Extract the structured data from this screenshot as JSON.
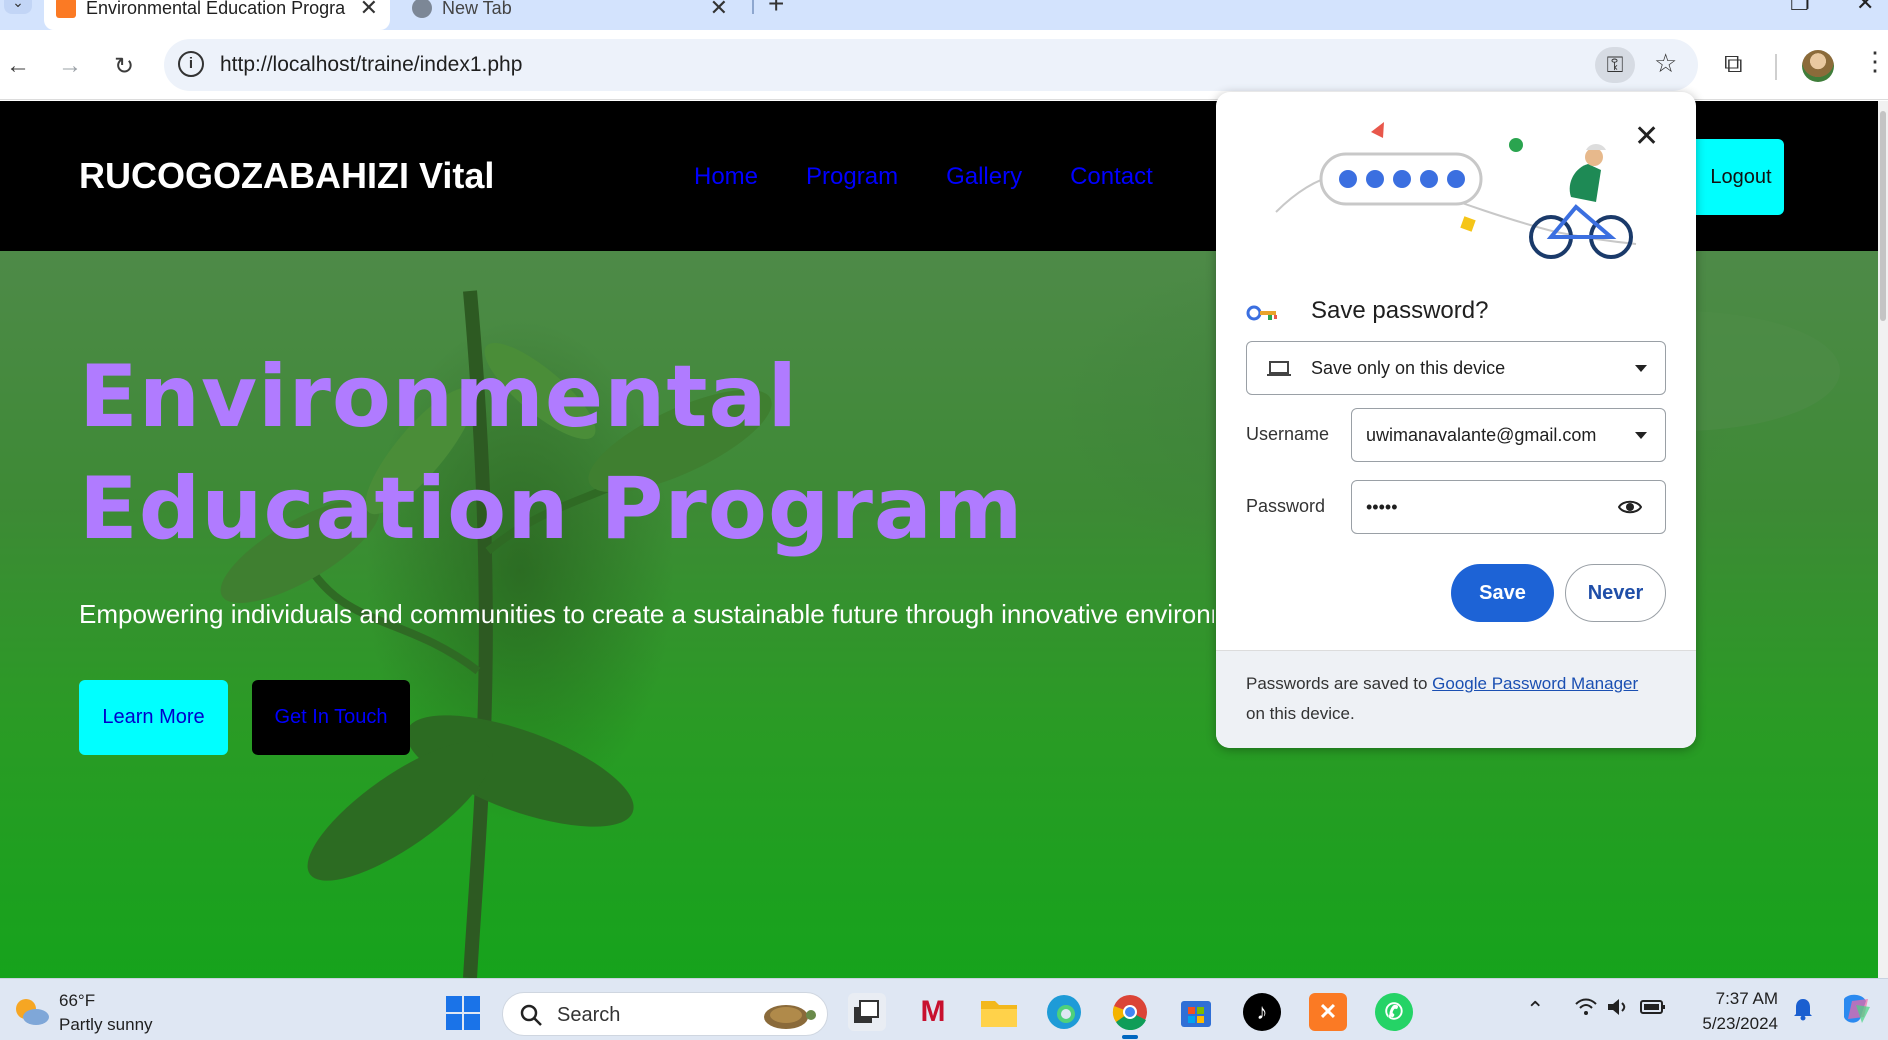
{
  "browser": {
    "tabs": [
      {
        "title": "Environmental Education Progra",
        "active": true,
        "favicon": "xampp-icon"
      },
      {
        "title": "New Tab",
        "active": false,
        "favicon": "globe-icon"
      }
    ],
    "url": "http://localhost/traine/index1.php"
  },
  "site": {
    "brand": "RUCOGOZABAHIZI Vital",
    "nav": [
      "Home",
      "Program",
      "Gallery",
      "Contact"
    ],
    "logout_label": "Logout",
    "hero_title": "Environmental Education Program",
    "hero_subtitle": "Empowering individuals and communities to create a sustainable future through innovative environm",
    "learn_more_label": "Learn More",
    "get_in_touch_label": "Get In Touch",
    "colors": {
      "header": "#000000",
      "accent": "#00ffff",
      "title": "#b07bff",
      "link": "#0000ff"
    }
  },
  "popup": {
    "title": "Save password?",
    "store_option": "Save only on this device",
    "username_label": "Username",
    "username_value": "uwimanavalante@gmail.com",
    "password_label": "Password",
    "password_value": "•••••",
    "save_label": "Save",
    "never_label": "Never",
    "footer_text_1": "Passwords are saved to ",
    "footer_link": "Google Password Manager",
    "footer_text_2": "on this device.",
    "colors": {
      "primary": "#1d63d6"
    }
  },
  "taskbar": {
    "weather_temp": "66°F",
    "weather_desc": "Partly sunny",
    "search_label": "Search",
    "time": "7:37 AM",
    "date": "5/23/2024",
    "apps": [
      "task-view-icon",
      "mcafee-icon",
      "file-explorer-icon",
      "edge-icon",
      "chrome-icon",
      "store-icon",
      "tiktok-icon",
      "xampp-icon",
      "whatsapp-icon"
    ]
  }
}
